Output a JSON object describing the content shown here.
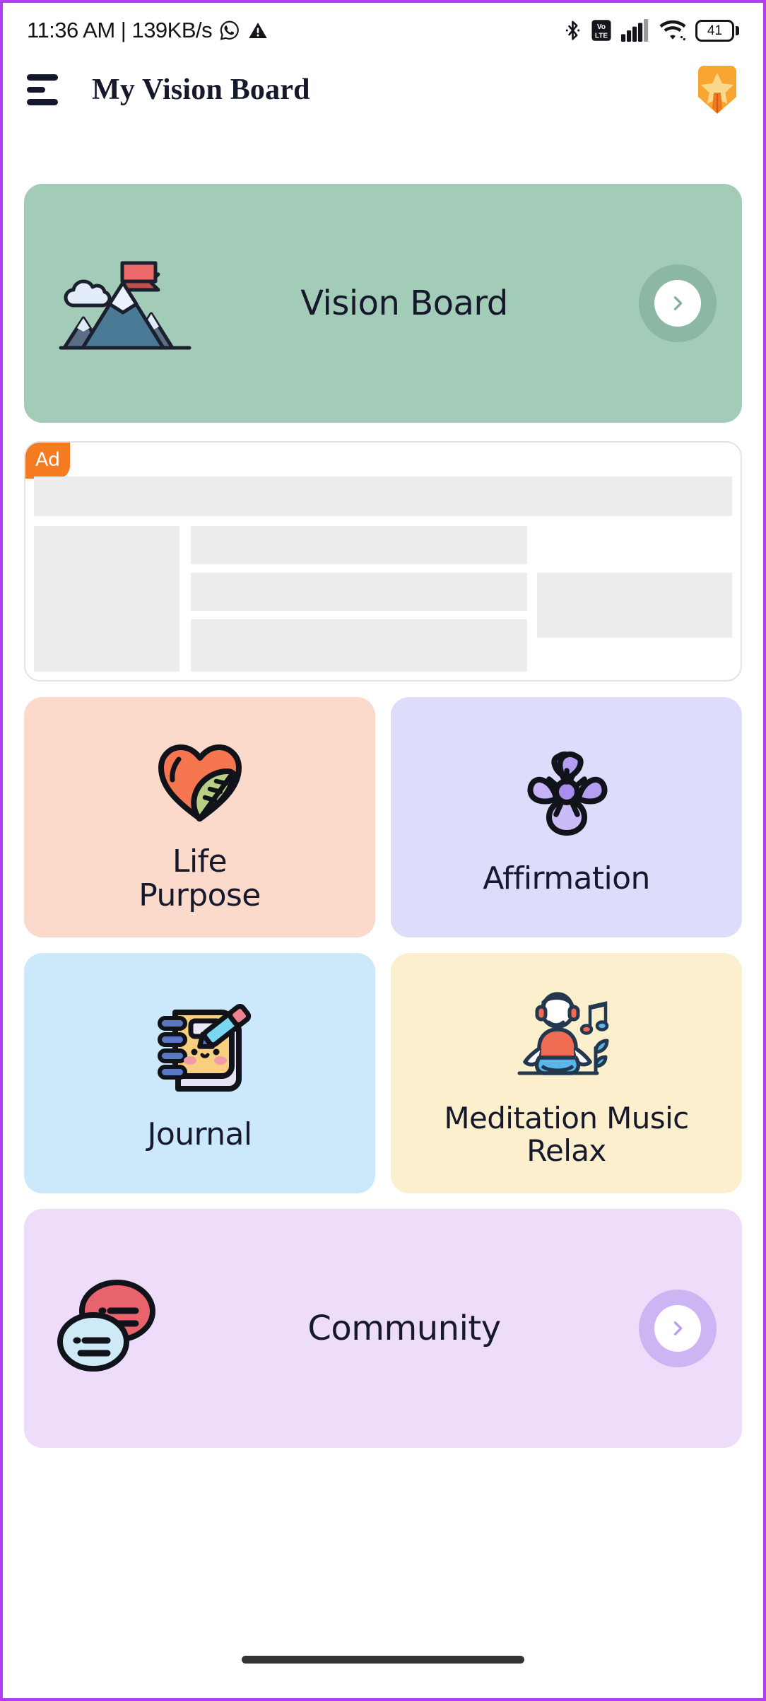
{
  "status_bar": {
    "time_and_speed": "11:36 AM | 139KB/s",
    "icons_left": [
      "whatsapp-icon",
      "warning-triangle-icon"
    ],
    "icons_right": [
      "bluetooth-icon",
      "volte-icon",
      "cellular-signal-icon",
      "wifi-icon"
    ],
    "volte_label_top": "Vo",
    "volte_label_bottom": "LTE",
    "battery_level": "41"
  },
  "app_bar": {
    "menu_icon": "hamburger-menu-icon",
    "title": "My Vision Board",
    "badge_icon": "star-shield-badge-icon"
  },
  "hero": {
    "label": "Vision Board",
    "icon": "mountain-flag-icon",
    "arrow_icon": "chevron-right-icon",
    "bg_color": "#a3ccb8",
    "arrow_ring_color": "#8cb8a3",
    "arrow_color": "#7fae9b"
  },
  "ad": {
    "badge_label": "Ad",
    "badge_color": "#f47b20",
    "placeholder_color": "#ededed"
  },
  "tiles": [
    {
      "label": "Life\nPurpose",
      "line1": "Life",
      "line2": "Purpose",
      "icon": "heart-leaf-icon",
      "bg_color": "#fbd9cb"
    },
    {
      "label": "Affirmation",
      "line1": "Affirmation",
      "line2": "",
      "icon": "flower-icon",
      "bg_color": "#dddcfa"
    },
    {
      "label": "Journal",
      "line1": "Journal",
      "line2": "",
      "icon": "notebook-pencil-icon",
      "bg_color": "#cce8fb"
    },
    {
      "label": "Meditation Music Relax",
      "line1": "Meditation Music",
      "line2": "Relax",
      "icon": "meditation-person-icon",
      "bg_color": "#fcefcd"
    }
  ],
  "community": {
    "label": "Community",
    "icon": "speech-bubbles-icon",
    "arrow_icon": "chevron-right-icon",
    "bg_color": "#eedcfb",
    "arrow_ring_color": "#cdb4f3",
    "arrow_color": "#b89bee"
  },
  "nav_bar": {
    "home_indicator": "home-indicator-pill"
  },
  "theme": {
    "text_color": "#16182c",
    "page_bg": "#ffffff",
    "frame_border": "#b33cf5"
  }
}
